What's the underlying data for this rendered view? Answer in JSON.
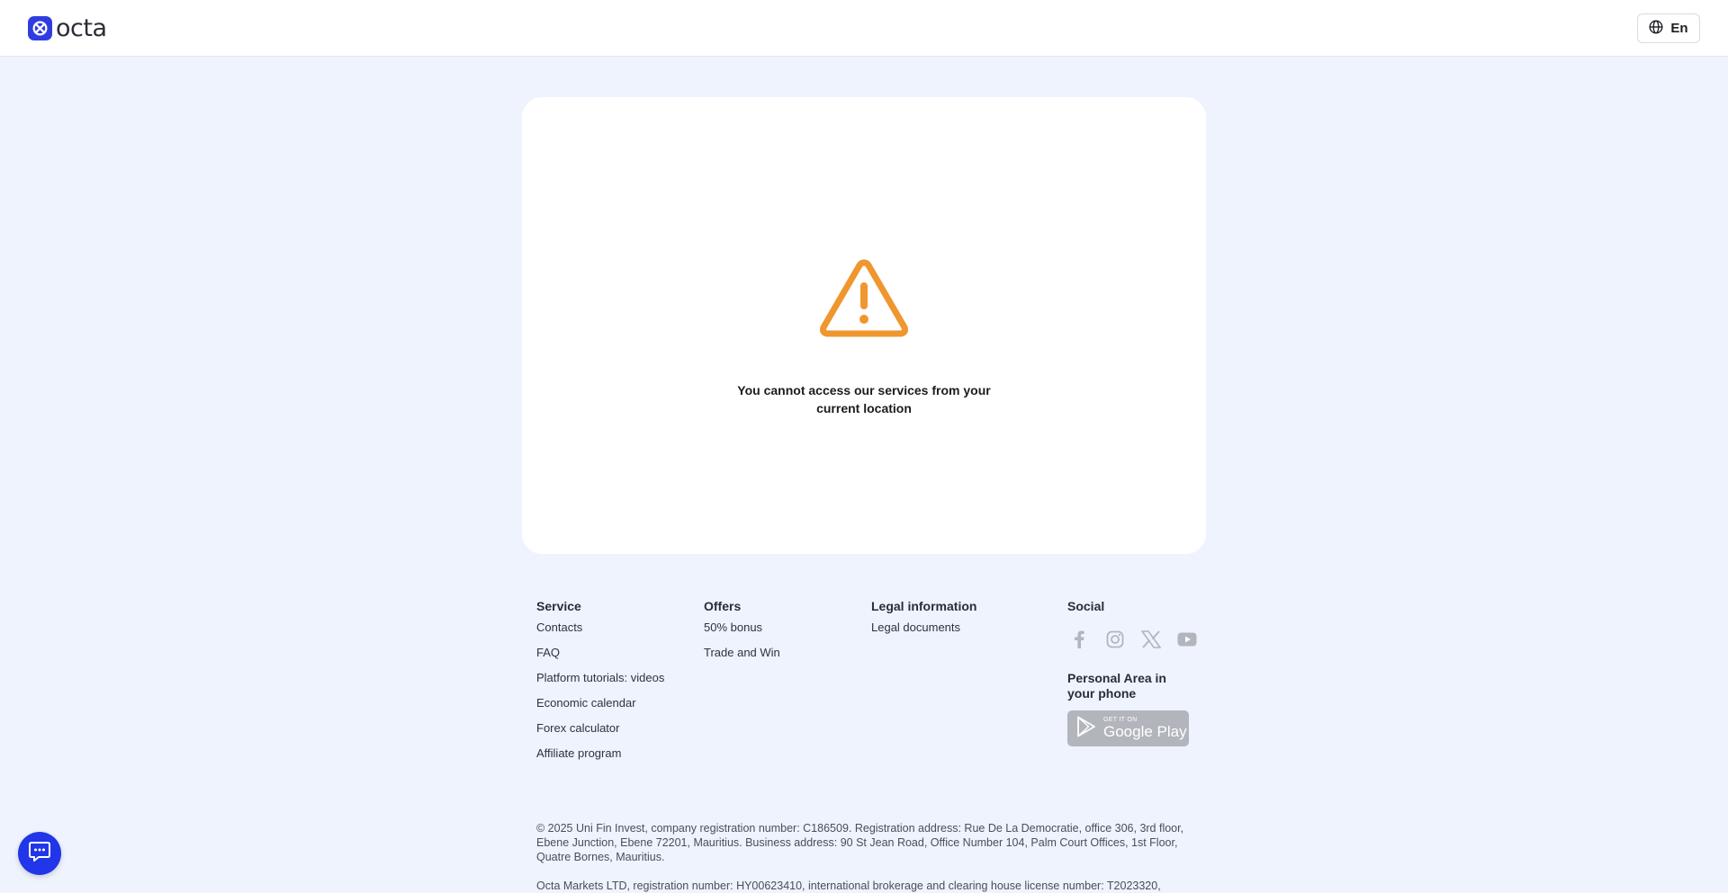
{
  "header": {
    "brand": "octa",
    "language": "En"
  },
  "card": {
    "message": "You cannot access our services from your current location"
  },
  "footer": {
    "service": {
      "title": "Service",
      "links": [
        "Contacts",
        "FAQ",
        "Platform tutorials: videos",
        "Economic calendar",
        "Forex calculator",
        "Affiliate program"
      ]
    },
    "offers": {
      "title": "Offers",
      "links": [
        "50% bonus",
        "Trade and Win"
      ]
    },
    "legal": {
      "title": "Legal information",
      "links": [
        "Legal documents"
      ]
    },
    "social": {
      "title": "Social",
      "icons": [
        "facebook-icon",
        "instagram-icon",
        "x-icon",
        "youtube-icon"
      ]
    },
    "phone": {
      "title": "Personal Area in your phone",
      "badge_small": "GET IT ON",
      "badge_big": "Google Play"
    },
    "legal_text": [
      "© 2025 Uni Fin Invest, company registration number: C186509. Registration address: Rue De La Democratie, office 306, 3rd floor, Ebene Junction, Ebene 72201, Mauritius. Business address: 90 St Jean Road, Office Number 104, Palm Court Offices, 1st Floor, Quatre Bornes, Mauritius.",
      "Octa Markets LTD, registration number: HY00623410, international brokerage and clearing house license number: T2023320,"
    ]
  },
  "colors": {
    "brand_blue": "#2f3de0",
    "warning_orange": "#f0962e",
    "chat_blue": "#2136e8",
    "page_bg": "#eef3fd"
  }
}
